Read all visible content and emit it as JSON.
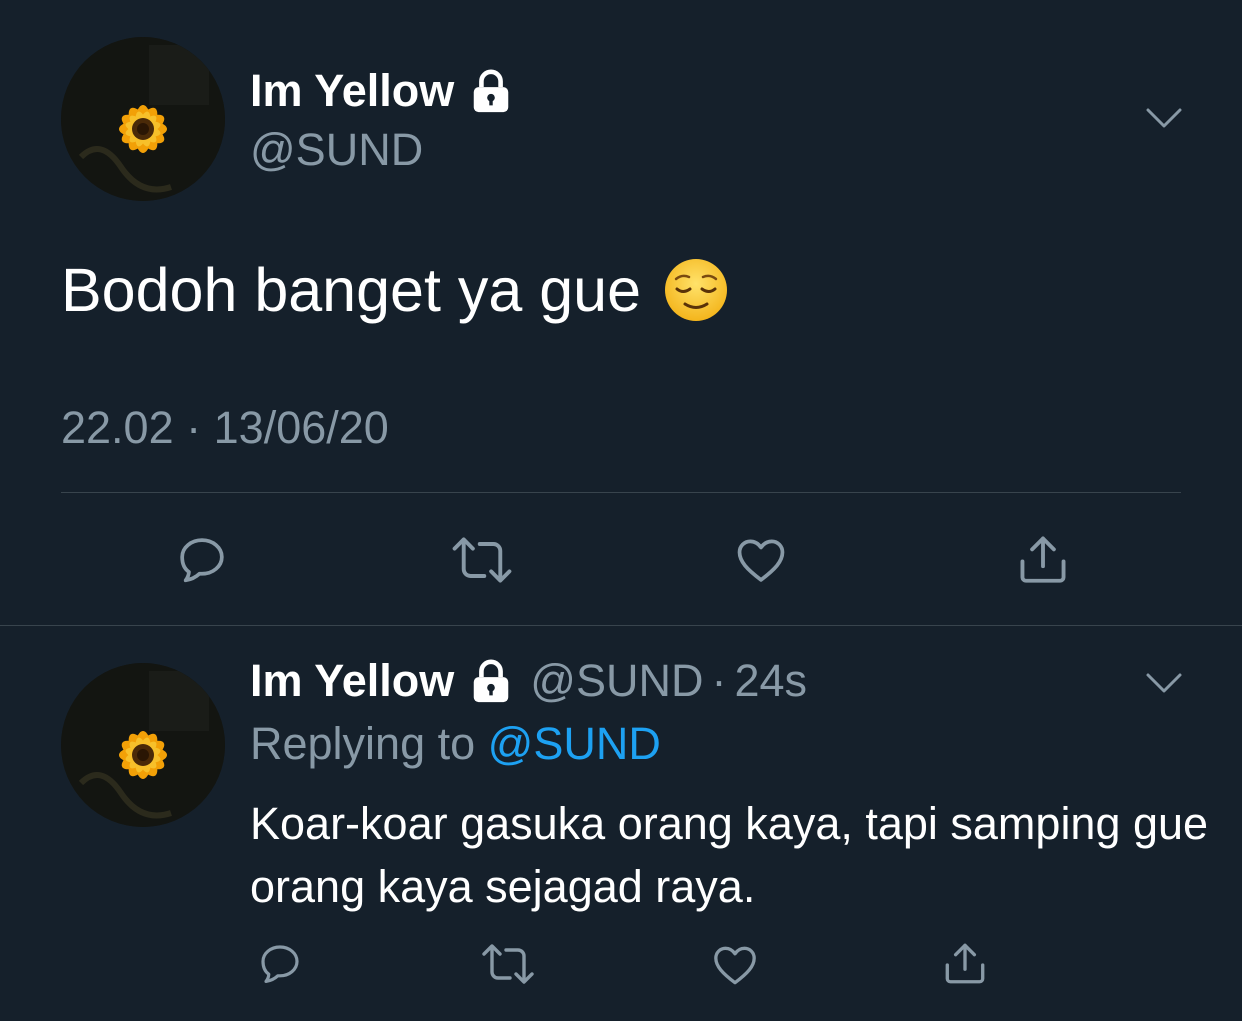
{
  "main_tweet": {
    "display_name": "Im Yellow",
    "handle": "@SUND",
    "text": "Bodoh banget ya gue",
    "emoji": "relieved-face",
    "time": "22.02",
    "separator": "·",
    "date": "13/06/20",
    "avatar": "sunflower-photo",
    "protected_icon": "lock-icon",
    "actions": [
      "reply-icon",
      "retweet-icon",
      "like-icon",
      "share-icon"
    ]
  },
  "reply_tweet": {
    "display_name": "Im Yellow",
    "handle": "@SUND",
    "separator": "·",
    "time": "24s",
    "replying_prefix": "Replying to ",
    "replying_to": "@SUND",
    "text": "Koar-koar gasuka orang kaya, tapi samping gue orang kaya sejagad raya.",
    "avatar": "sunflower-photo",
    "protected_icon": "lock-icon",
    "actions": [
      "reply-icon",
      "retweet-icon",
      "like-icon",
      "share-icon"
    ]
  },
  "colors": {
    "background": "#15202b",
    "secondary_text": "#8899a6",
    "link": "#1da1f2",
    "divider": "#38444d"
  }
}
